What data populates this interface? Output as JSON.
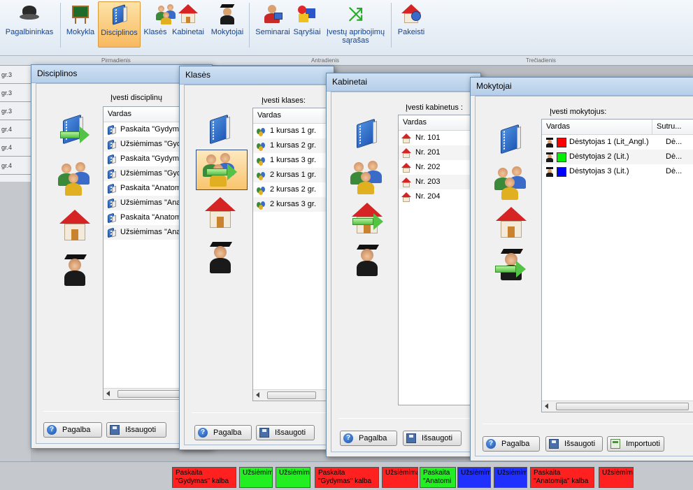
{
  "toolbar": {
    "items": [
      {
        "label": "Pagalbininkas",
        "icon": "helper-hat-icon"
      },
      {
        "label": "Mokykla",
        "icon": "blackboard-icon"
      },
      {
        "label": "Disciplinos",
        "icon": "book-icon"
      },
      {
        "label": "Klasės",
        "icon": "group-icon"
      },
      {
        "label": "Kabinetai",
        "icon": "house-icon"
      },
      {
        "label": "Mokytojai",
        "icon": "teacher-icon"
      },
      {
        "label": "Seminarai",
        "icon": "seminar-icon"
      },
      {
        "label": "Sąryšiai",
        "icon": "shapes-icon"
      },
      {
        "label": "Įvestų apribojimų sąrašas",
        "icon": "shuffle-icon"
      },
      {
        "label": "Pakeisti",
        "icon": "replace-icon"
      }
    ]
  },
  "grid": {
    "days": [
      "Pirmadienis",
      "Antradienis",
      "Trečiadienis"
    ],
    "rows": [
      "gr.3",
      "gr.3",
      "gr.3",
      "gr.4",
      "gr.4",
      "gr.4"
    ]
  },
  "dialogs": {
    "disciplinos": {
      "title": "Disciplinos",
      "prompt": "Įvesti disciplinų",
      "col": "Vardas",
      "rows": [
        "Paskaita \"Gydymas",
        "Užsiėmimas \"Gydy",
        "Paskaita \"Gydymas",
        "Užsiėmimas \"Gydy",
        "Paskaita \"Anatomi",
        "Užsiėmimas \"Anato",
        "Paskaita \"Anatomi",
        "Užsiėmimas \"Anato"
      ],
      "help": "Pagalba",
      "save": "Išsaugoti"
    },
    "klases": {
      "title": "Klasės",
      "prompt": "Įvesti klases:",
      "col": "Vardas",
      "rows": [
        "1 kursas 1 gr.",
        "1 kursas 2 gr.",
        "1 kursas 3 gr.",
        "2 kursas 1 gr.",
        "2 kursas 2 gr.",
        "2 kursas 3 gr."
      ],
      "help": "Pagalba",
      "save": "Išsaugoti"
    },
    "kabinetai": {
      "title": "Kabinetai",
      "prompt": "Įvesti kabinetus :",
      "col": "Vardas",
      "rows": [
        "Nr. 101",
        "Nr. 201",
        "Nr. 202",
        "Nr. 203",
        "Nr. 204"
      ],
      "help": "Pagalba",
      "save": "Išsaugoti"
    },
    "mokytojai": {
      "title": "Mokytojai",
      "prompt": "Įvesti mokytojus:",
      "col1": "Vardas",
      "col2": "Sutru...",
      "rows": [
        {
          "name": "Dėstytojas 1 (Lit_Angl.)",
          "short": "Dė...",
          "color": "#ff0000"
        },
        {
          "name": "Dėstytojas 2 (Lit.)",
          "short": "Dė...",
          "color": "#00ee00"
        },
        {
          "name": "Dėstytojas 3 (Lit.)",
          "short": "Dė...",
          "color": "#0000ff"
        }
      ],
      "help": "Pagalba",
      "save": "Išsaugoti",
      "import": "Importuoti"
    }
  },
  "chips": [
    {
      "text": "Paskaita \"Gydymas\" kalba",
      "color": "#ff2020"
    },
    {
      "text": "Užsiėmimas",
      "color": "#22ee22"
    },
    {
      "text": "Užsiėmimas",
      "color": "#22ee22"
    },
    {
      "text": "Paskaita \"Gydymas\" kalba",
      "color": "#ff2020"
    },
    {
      "text": "Užsiėmimas",
      "color": "#ff2020"
    },
    {
      "text": "Paskaita \"Anatomi",
      "color": "#22ee22"
    },
    {
      "text": "Užsiėmimas",
      "color": "#2030ff"
    },
    {
      "text": "Užsiėmimas",
      "color": "#2030ff"
    },
    {
      "text": "Paskaita \"Anatomija\" kalba",
      "color": "#ff2020"
    },
    {
      "text": "Užsiėmimas",
      "color": "#ff2020"
    }
  ]
}
